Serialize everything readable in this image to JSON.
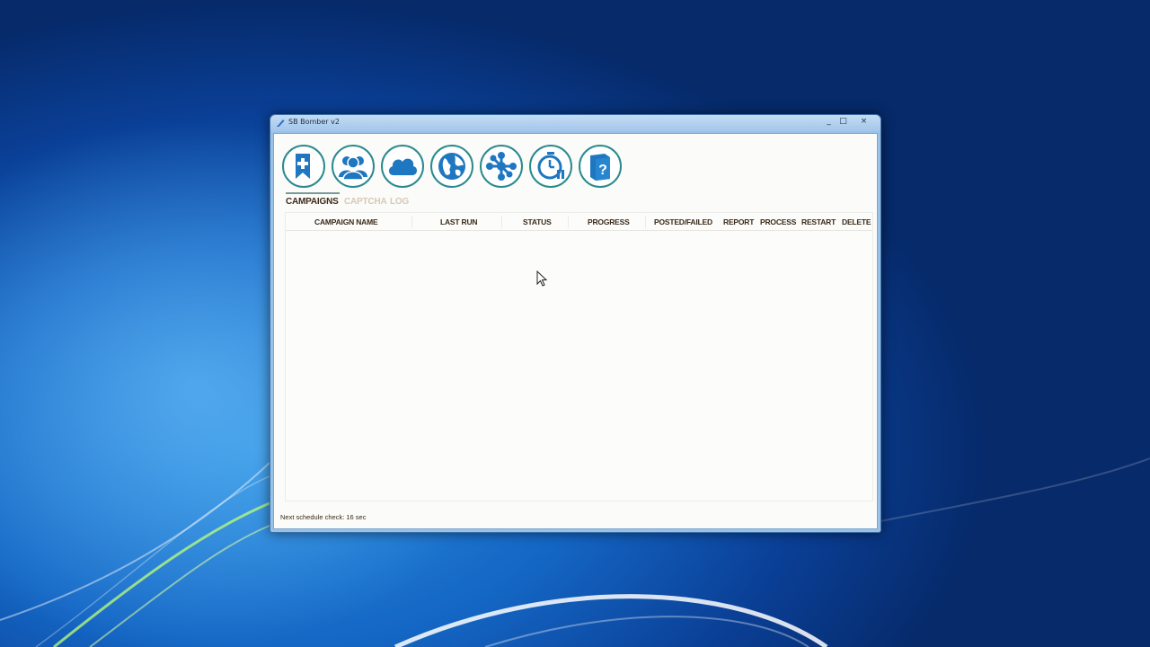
{
  "window": {
    "title": "SB Bomber v2",
    "minimize": "_",
    "maximize": "□",
    "close": "×"
  },
  "toolbar": {
    "buttons": [
      {
        "name": "new-campaign",
        "icon": "bookmark-plus-icon"
      },
      {
        "name": "accounts",
        "icon": "users-icon"
      },
      {
        "name": "cloud",
        "icon": "cloud-icon"
      },
      {
        "name": "web",
        "icon": "globe-icon"
      },
      {
        "name": "network",
        "icon": "network-icon"
      },
      {
        "name": "scheduler",
        "icon": "stopwatch-icon"
      },
      {
        "name": "help",
        "icon": "help-book-icon"
      }
    ]
  },
  "tabs": [
    {
      "label": "CAMPAIGNS",
      "active": true
    },
    {
      "label": "CAPTCHA",
      "active": false
    },
    {
      "label": "LOG",
      "active": false
    }
  ],
  "table": {
    "columns": [
      "CAMPAIGN NAME",
      "LAST RUN",
      "STATUS",
      "PROGRESS",
      "POSTED/FAILED",
      "REPORT",
      "PROCESS",
      "RESTART",
      "DELETE"
    ],
    "rows": []
  },
  "status": {
    "text": "Next schedule check: 16 sec"
  },
  "colors": {
    "icon_teal": "#2a8a8e",
    "icon_blue": "#1e77c0",
    "header_text": "#3b2a17",
    "tab_inactive": "#d7c9b4"
  }
}
